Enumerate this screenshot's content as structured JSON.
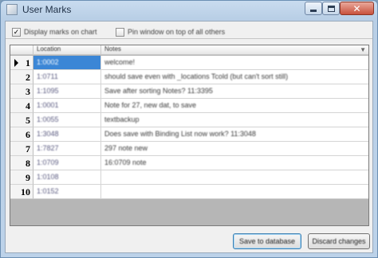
{
  "window": {
    "title": "User Marks"
  },
  "options": [
    {
      "label": "Display marks on chart",
      "checked": true
    },
    {
      "label": "Pin window on top of all others",
      "checked": false
    }
  ],
  "grid": {
    "columns": [
      "Location",
      "Notes"
    ],
    "rows": [
      {
        "num": "1",
        "location": "1:0002",
        "notes": "welcome!"
      },
      {
        "num": "2",
        "location": "1:0711",
        "notes": "should save even with _locations Tcold (but can't sort still)"
      },
      {
        "num": "3",
        "location": "1:1095",
        "notes": "Save after sorting Notes? 11:3395"
      },
      {
        "num": "4",
        "location": "1:0001",
        "notes": "Note for 27, new dat, to save"
      },
      {
        "num": "5",
        "location": "1:0055",
        "notes": "textbackup"
      },
      {
        "num": "6",
        "location": "1:3048",
        "notes": "Does save with Binding List now work? 11:3048"
      },
      {
        "num": "7",
        "location": "1:7827",
        "notes": "297 note new"
      },
      {
        "num": "8",
        "location": "1:0709",
        "notes": "16:0709 note"
      },
      {
        "num": "9",
        "location": "1:0108",
        "notes": ""
      },
      {
        "num": "10",
        "location": "1:0152",
        "notes": ""
      }
    ]
  },
  "buttons": {
    "save": "Save to database",
    "discard": "Discard changes"
  },
  "icons": {
    "app": "app-icon",
    "minimize": "minimize-icon",
    "maximize": "maximize-icon",
    "close": "close-icon",
    "current_row": "current-row-arrow-icon",
    "close_glyph": "✕"
  },
  "colors": {
    "selection": "#3b86d6",
    "grid_bg": "#b6b6b6",
    "title_bg": "#c9dcef"
  }
}
